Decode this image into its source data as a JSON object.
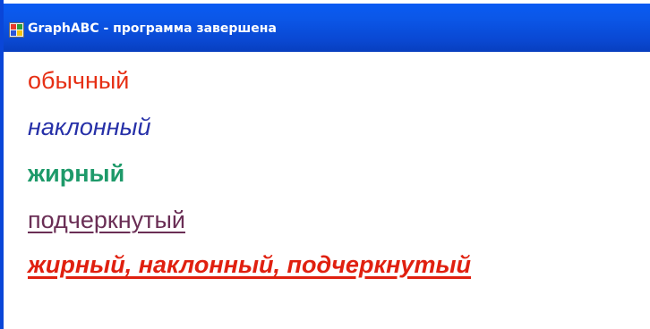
{
  "window": {
    "title": "GraphABC - программа завершена",
    "icon": "graphabc-app-icon"
  },
  "canvas": {
    "lines": [
      {
        "text": "обычный",
        "style": "regular",
        "color": "#e62f14"
      },
      {
        "text": "наклонный",
        "style": "italic",
        "color": "#2630a8"
      },
      {
        "text": "жирный",
        "style": "bold",
        "color": "#1e9a6a"
      },
      {
        "text": "подчеркнутый",
        "style": "underline",
        "color": "#6a2e55"
      },
      {
        "text": "жирный, наклонный, подчеркнутый",
        "style": "bold italic underline",
        "color": "#e0200f"
      }
    ]
  },
  "colors": {
    "titlebar": "#0a49d4",
    "background": "#ffffff"
  }
}
